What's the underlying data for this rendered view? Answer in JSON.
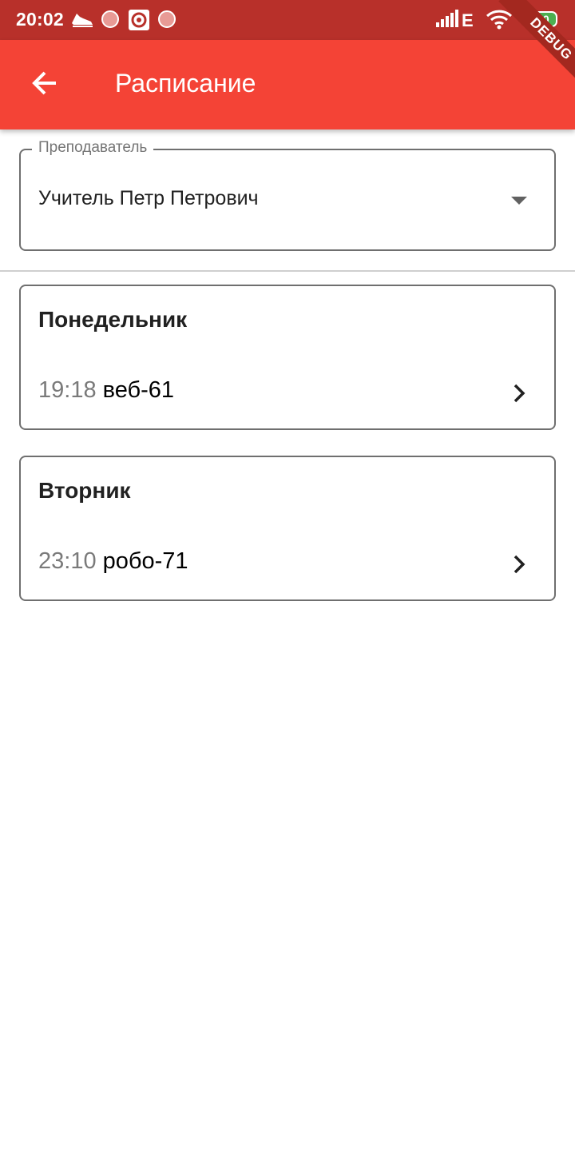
{
  "status_bar": {
    "time": "20:02",
    "network": "E",
    "battery": "100"
  },
  "debug_banner": "DEBUG",
  "app_bar": {
    "title": "Расписание"
  },
  "teacher_select": {
    "label": "Преподаватель",
    "value": "Учитель Петр Петрович"
  },
  "days": [
    {
      "name": "Понедельник",
      "lessons": [
        {
          "time": "19:18",
          "group": "веб-61"
        }
      ]
    },
    {
      "name": "Вторник",
      "lessons": [
        {
          "time": "23:10",
          "group": "робо-71"
        }
      ]
    }
  ],
  "colors": {
    "status_bar": "#b8302a",
    "app_bar": "#f44336",
    "outline": "#6f6f6f",
    "battery": "#4caf50"
  }
}
